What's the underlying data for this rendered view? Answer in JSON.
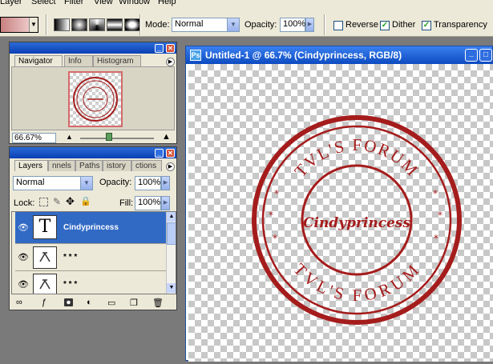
{
  "menubar": {
    "items": [
      "Layer",
      "Select",
      "Filter",
      "View",
      "Window",
      "Help"
    ]
  },
  "options": {
    "mode_label": "Mode:",
    "mode_value": "Normal",
    "opacity_label": "Opacity:",
    "opacity_value": "100%",
    "reverse_label": "Reverse",
    "reverse_checked": false,
    "dither_label": "Dither",
    "dither_checked": true,
    "transparency_label": "Transparency",
    "transparency_checked": true,
    "gradient_colors": [
      "#c98080",
      "#f6dede"
    ]
  },
  "navigator": {
    "tabs": [
      "Navigator",
      "Info",
      "Histogram"
    ],
    "zoom_value": "66.67%"
  },
  "layers_panel": {
    "tabs": [
      "Layers",
      "nnels",
      "Paths",
      "istory",
      "ctions"
    ],
    "blend_mode": "Normal",
    "opacity_label": "Opacity:",
    "opacity_value": "100%",
    "lock_label": "Lock:",
    "fill_label": "Fill:",
    "fill_value": "100%",
    "layers": [
      {
        "name": "Cindyprincess",
        "thumb": "T",
        "selected": true
      },
      {
        "name": "* * *",
        "thumb": "",
        "selected": false
      },
      {
        "name": "* * *",
        "thumb": "",
        "selected": false
      }
    ]
  },
  "document": {
    "title": "Untitled-1 @ 66.7% (Cindyprincess, RGB/8)",
    "stamp_color": "#a51c1c",
    "stamp_top_text": "TVL'S FORUM",
    "stamp_bottom_text": "TVL'S FORUM",
    "stamp_center_text": "Cindyprincess"
  }
}
